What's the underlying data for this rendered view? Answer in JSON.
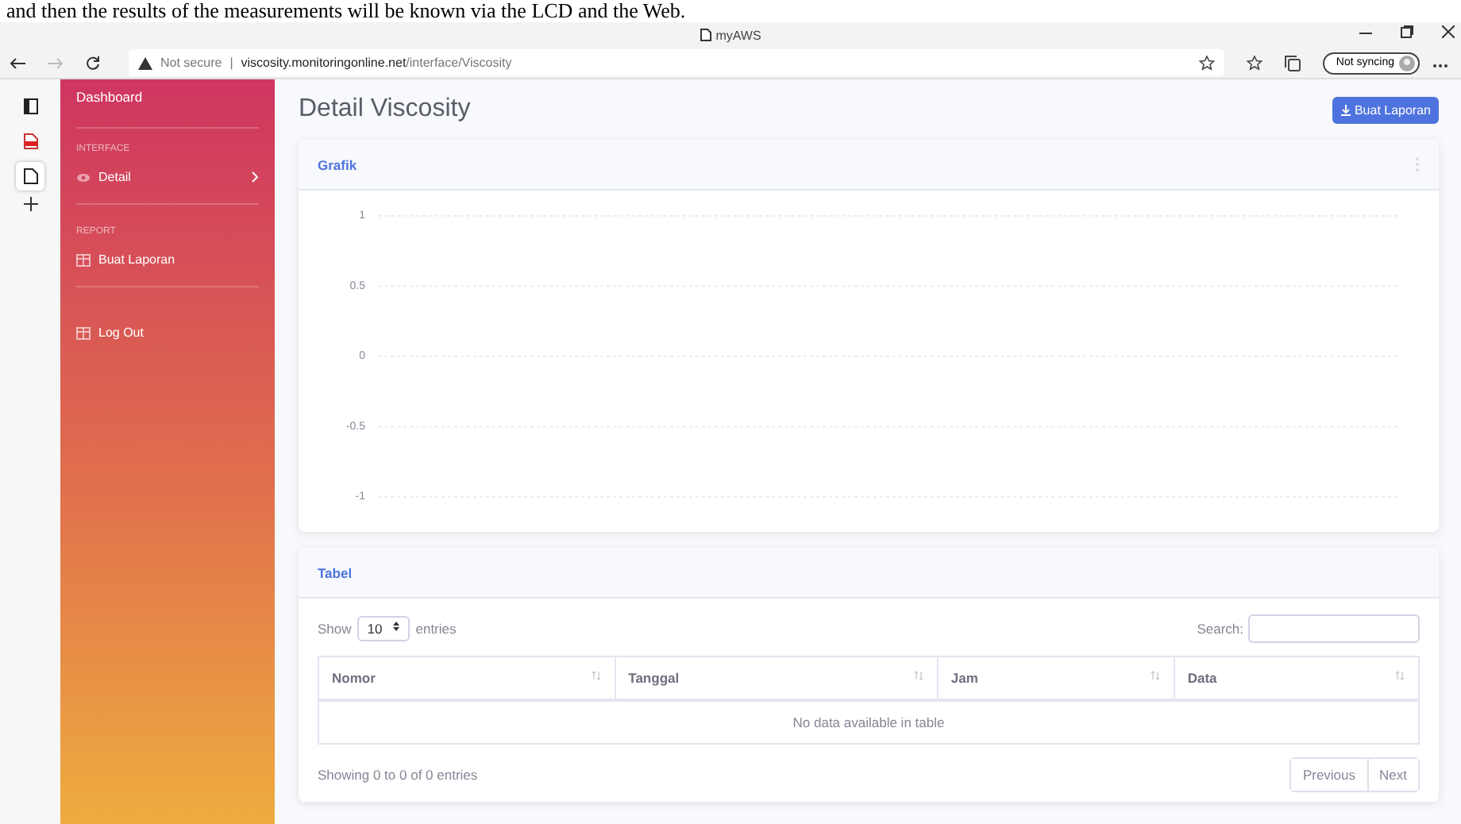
{
  "caption": "and then the results of the measurements will be known via the LCD and the Web.",
  "window": {
    "title": "myAWS"
  },
  "address_bar": {
    "security": "Not secure",
    "separator": "|",
    "host": "viscosity.monitoringonline.net",
    "path": "/interface/Viscosity"
  },
  "profile": {
    "label": "Not syncing"
  },
  "vertical_tabs": [
    {
      "kind": "panel",
      "selected": false
    },
    {
      "kind": "pdf",
      "selected": false
    },
    {
      "kind": "page",
      "selected": true
    }
  ],
  "sidebar": {
    "brand": "Dashboard",
    "sections": [
      {
        "heading": "INTERFACE",
        "items": [
          {
            "label": "Detail",
            "kind": "collapsible"
          }
        ]
      },
      {
        "heading": "REPORT",
        "items": [
          {
            "label": "Buat Laporan",
            "kind": "link"
          }
        ]
      },
      {
        "items": [
          {
            "label": "Log Out",
            "kind": "link"
          }
        ]
      }
    ]
  },
  "page": {
    "title": "Detail Viscosity",
    "action_button": "Buat Laporan"
  },
  "chart_card": {
    "title": "Grafik",
    "y_axis_labels": [
      "1",
      "0.5",
      "0",
      "-0.5",
      "-1"
    ]
  },
  "table_card": {
    "title": "Tabel",
    "show_label": "Show",
    "page_size": "10",
    "entries_label": "entries",
    "search_label": "Search:",
    "columns": [
      "Nomor",
      "Tanggal",
      "Jam",
      "Data"
    ],
    "empty_message": "No data available in table",
    "info": "Showing 0 to 0 of 0 entries",
    "pagination": [
      {
        "label": "Previous",
        "disabled": true
      },
      {
        "label": "Next",
        "disabled": true
      }
    ]
  }
}
